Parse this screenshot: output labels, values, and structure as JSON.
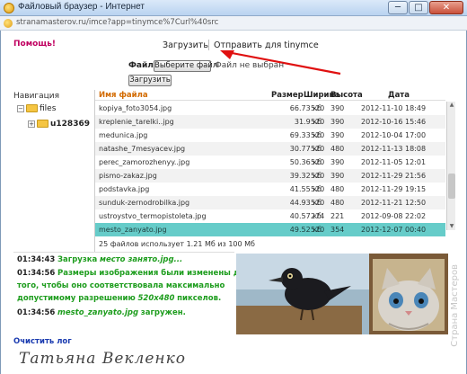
{
  "window": {
    "title": "Файловый браузер - Интернет",
    "url": "stranamasterov.ru/imce?app=tinymce%7Curl%40src",
    "min_label": "─",
    "max_label": "□",
    "close_label": "✕"
  },
  "toolbar": {
    "help": "Помощь!",
    "tab_upload": "Загрузить",
    "tab_send": "Отправить для tinymce"
  },
  "upload_form": {
    "file_label": "Файл:",
    "choose_button": "Выберите файл",
    "no_file": "Файл не выбран",
    "upload_button": "Загрузить"
  },
  "navigation": {
    "title": "Навигация",
    "root": "files",
    "child": "u128369"
  },
  "grid": {
    "headers": {
      "name": "Имя файла",
      "size": "Размер",
      "width": "Ширина",
      "height": "Высота",
      "date": "Дата"
    },
    "rows": [
      {
        "name": "kopiya_foto3054.jpg",
        "size": "66.73 кб",
        "w": "520",
        "h": "390",
        "date": "2012-11-10 18:49"
      },
      {
        "name": "kreplenie_tarelki..jpg",
        "size": "31.9 кб",
        "w": "520",
        "h": "390",
        "date": "2012-10-16 15:46"
      },
      {
        "name": "medunica.jpg",
        "size": "69.33 кб",
        "w": "520",
        "h": "390",
        "date": "2012-10-04 17:00"
      },
      {
        "name": "natashe_7mesyacev.jpg",
        "size": "30.77 кб",
        "w": "520",
        "h": "480",
        "date": "2012-11-13 18:08"
      },
      {
        "name": "perec_zamorozhenyy..jpg",
        "size": "50.36 кб",
        "w": "520",
        "h": "390",
        "date": "2012-11-05 12:01"
      },
      {
        "name": "pismo-zakaz.jpg",
        "size": "39.32 кб",
        "w": "520",
        "h": "390",
        "date": "2012-11-29 21:56"
      },
      {
        "name": "podstavka.jpg",
        "size": "41.55 кб",
        "w": "520",
        "h": "480",
        "date": "2012-11-29 19:15"
      },
      {
        "name": "sunduk-zernodrobilka.jpg",
        "size": "44.93 кб",
        "w": "520",
        "h": "480",
        "date": "2012-11-21 12:50"
      },
      {
        "name": "ustroystvo_termopistoleta.jpg",
        "size": "40.57 кб",
        "w": "274",
        "h": "221",
        "date": "2012-09-08 22:02"
      },
      {
        "name": "mesto_zanyato.jpg",
        "size": "49.52 кб",
        "w": "520",
        "h": "354",
        "date": "2012-12-07 00:40"
      }
    ],
    "summary": "25 файлов использует 1.21 Мб из 100 Мб"
  },
  "log": {
    "l1_time": "01:34:43",
    "l1_text": "Загрузка",
    "l1_file": "место занято.jpg...",
    "l2_time": "01:34:56",
    "l2_text_a": "Размеры изображения были изменены для",
    "l2_text_b": "того, чтобы оно соответствовала максимально",
    "l2_text_c": "допустимому разрешению",
    "l2_res": "520x480",
    "l2_text_d": "пикселов.",
    "l3_time": "01:34:56",
    "l3_file": "mesto_zanyato.jpg",
    "l3_text": "загружен.",
    "clear": "Очистить лог"
  },
  "signature": "Татьяна Векленко",
  "watermark": "Страна Мастеров",
  "colors": {
    "selected_row": "#66ccc9",
    "accent_link": "#c00060",
    "log_ok": "#1e9d1e"
  }
}
